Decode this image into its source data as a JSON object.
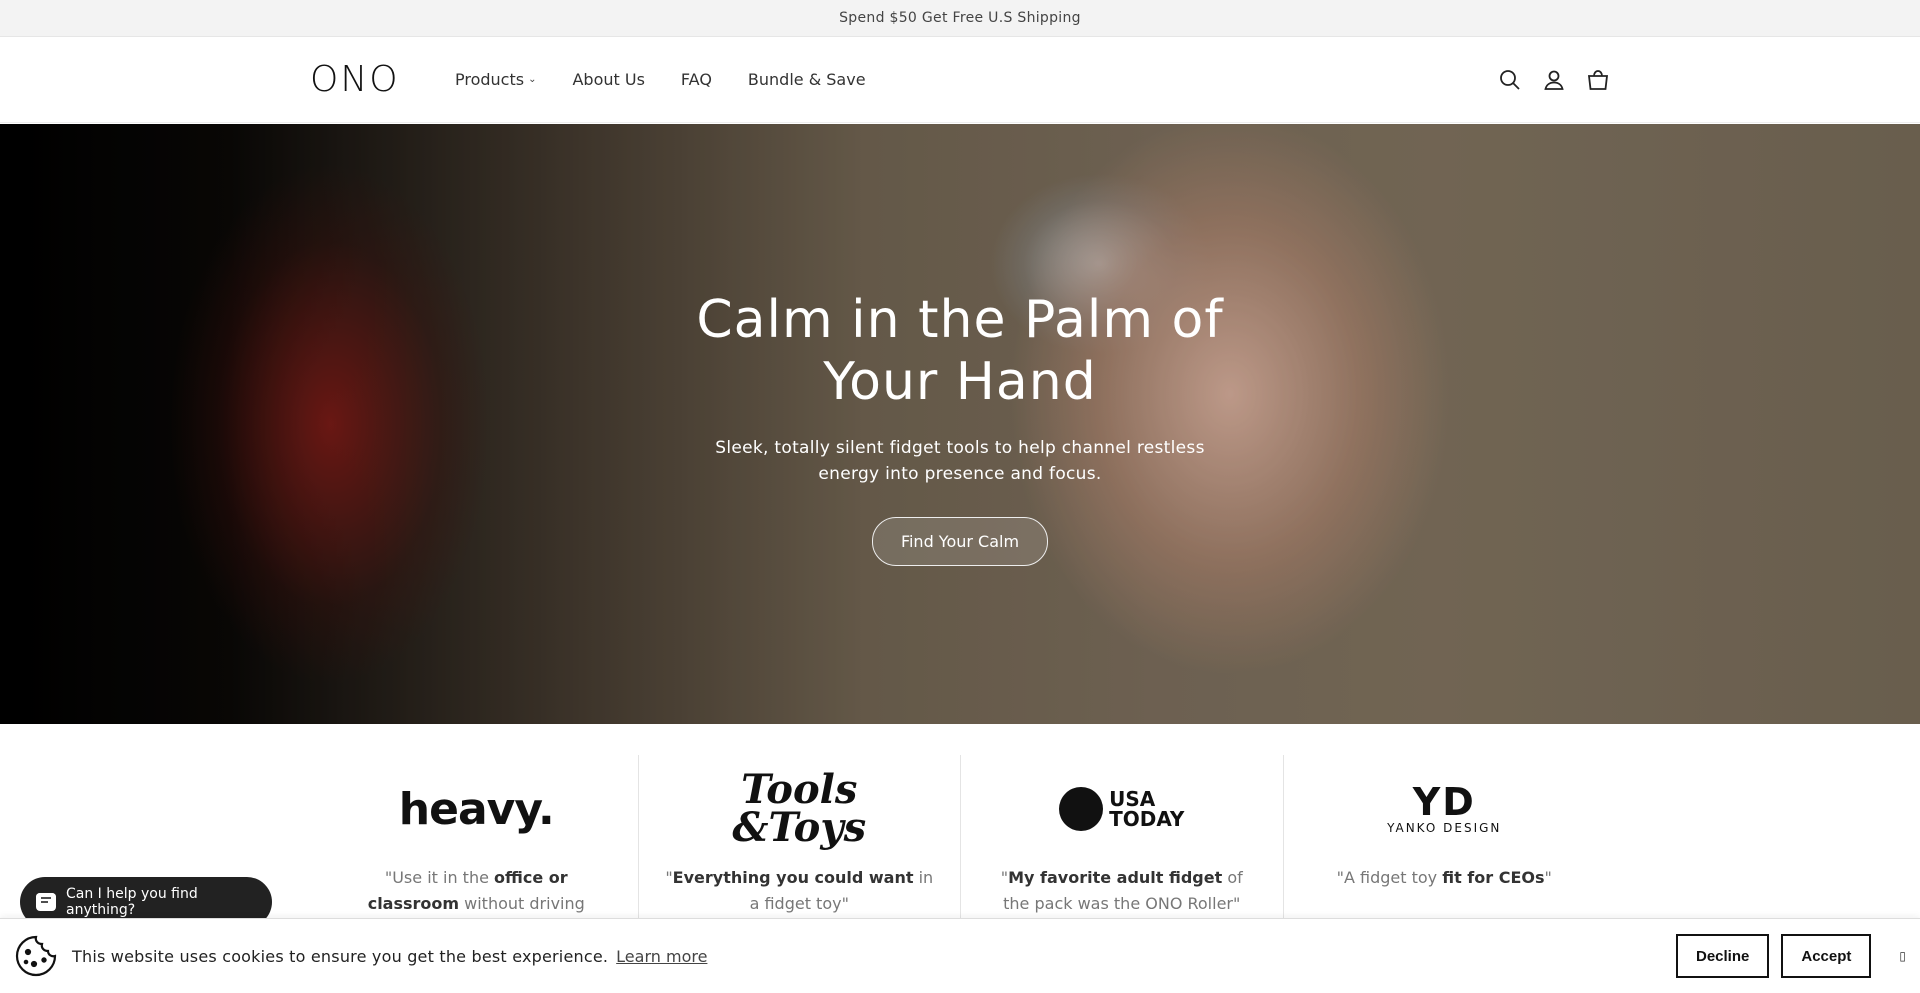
{
  "announcement": "Spend $50 Get Free U.S Shipping",
  "header": {
    "logo": "ONO",
    "nav": [
      {
        "label": "Products"
      },
      {
        "label": "About Us"
      },
      {
        "label": "FAQ"
      },
      {
        "label": "Bundle & Save"
      }
    ],
    "icons": [
      "search-icon",
      "account-icon",
      "cart-icon"
    ]
  },
  "hero": {
    "title_line1": "Calm in the Palm of",
    "title_line2": "Your Hand",
    "subtitle_line1": "Sleek, totally silent fidget tools to help channel restless",
    "subtitle_line2": "energy into presence and focus.",
    "cta": "Find Your Calm"
  },
  "press": [
    {
      "logo": "heavy.",
      "quote_pre": "\"Use it in the ",
      "quote_bold": "office or classroom",
      "quote_post": " without driving others crazy\""
    },
    {
      "logo_line1": "Tools",
      "logo_line2": "&Toys",
      "quote_pre": "\"",
      "quote_bold": "Everything you could want",
      "quote_post": " in a fidget toy\""
    },
    {
      "logo_line1": "USA",
      "logo_line2": "TODAY",
      "quote_pre": "\"",
      "quote_bold": "My favorite adult fidget",
      "quote_post": " of the pack was the ONO Roller\""
    },
    {
      "logo_big": "YD",
      "logo_small": "YANKO DESIGN",
      "quote_pre": "\"A fidget toy ",
      "quote_bold": "fit for CEOs",
      "quote_post": "\""
    }
  ],
  "chat": {
    "label": "Can I help you find anything?"
  },
  "cookie": {
    "text": "This website uses cookies to ensure you get the best experience.",
    "link": "Learn more",
    "decline": "Decline",
    "accept": "Accept",
    "close": "▯"
  }
}
